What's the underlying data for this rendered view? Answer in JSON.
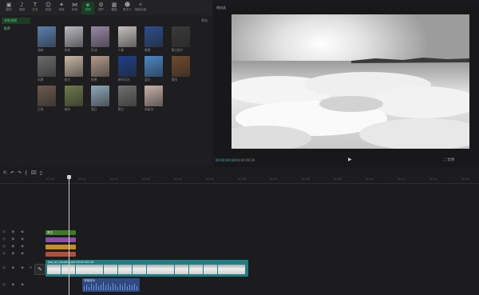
{
  "toolbar": {
    "items": [
      {
        "label": "媒体",
        "icon": "media-icon"
      },
      {
        "label": "音频",
        "icon": "audio-icon"
      },
      {
        "label": "文本",
        "icon": "text-icon"
      },
      {
        "label": "贴纸",
        "icon": "sticker-icon"
      },
      {
        "label": "特效",
        "icon": "effects-icon"
      },
      {
        "label": "转场",
        "icon": "transition-icon"
      },
      {
        "label": "滤镜",
        "icon": "filter-icon"
      },
      {
        "label": "调节",
        "icon": "adjust-icon"
      },
      {
        "label": "模板",
        "icon": "template-icon"
      },
      {
        "label": "数字人",
        "icon": "avatar-icon"
      },
      {
        "label": "智能包装",
        "icon": "smart-pack-icon"
      }
    ],
    "active_index": 6
  },
  "media": {
    "categories": [
      {
        "label": "本地滤镜"
      },
      {
        "label": "推荐"
      }
    ],
    "sort_label": "筛选",
    "thumbs": [
      {
        "label": "清新",
        "color": "#5a7fae"
      },
      {
        "label": "质感",
        "color": "#b9b9c2"
      },
      {
        "label": "奶油",
        "color": "#9a88a6"
      },
      {
        "label": "人像",
        "color": "#c5c2bd"
      },
      {
        "label": "美食",
        "color": "#2c4e8c"
      },
      {
        "label": "黑白胶片",
        "color": "#3a3a3a"
      },
      {
        "label": "风景",
        "color": "#6b6b6b"
      },
      {
        "label": "复古",
        "color": "#c7b7a6"
      },
      {
        "label": "夜景",
        "color": "#b19b8a"
      },
      {
        "label": "城市风光",
        "color": "#1d3f88"
      },
      {
        "label": "蓝天",
        "color": "#4a88c9"
      },
      {
        "label": "暖阳",
        "color": "#6f4a2f"
      },
      {
        "label": "日系",
        "color": "#6c5a4f"
      },
      {
        "label": "森系",
        "color": "#6e7a4a"
      },
      {
        "label": "落日",
        "color": "#8fa7b8"
      },
      {
        "label": "黑白",
        "color": "#707070"
      },
      {
        "label": "高级灰",
        "color": "#c9b2aa"
      }
    ]
  },
  "preview": {
    "title": "播放器",
    "time_current": "00:00:00:00",
    "time_total": "00:00:09:26",
    "ratio_label": "比例",
    "colors": {
      "sky": "#cfcfcf",
      "cloud": "#f0f0f0"
    }
  },
  "timeline": {
    "tool_icons": [
      "select-icon",
      "undo-icon",
      "redo-icon",
      "split-icon",
      "delete-icon",
      "freeze-icon"
    ],
    "ticks": [
      "00:00",
      "00:01",
      "00:02",
      "00:03",
      "00:04",
      "00:05",
      "00:06",
      "00:07",
      "00:08",
      "00:09",
      "00:10",
      "00:11",
      "00:12",
      "00:13",
      "00:14"
    ],
    "tracks": {
      "filter": {
        "label": "黑白",
        "color": "#3f7a2a"
      },
      "effect": {
        "label": "",
        "color": "#8a4fa6"
      },
      "sticker": {
        "label": "",
        "color": "#c58e2b"
      },
      "text": {
        "label": "",
        "color": "#b0503a"
      }
    },
    "main_clip": {
      "title": "sea_of_clouds.mp4  00:00:09:26",
      "color": "#1f7e86"
    },
    "audio_clip": {
      "label": "背景音乐",
      "color": "#2f4a82"
    }
  }
}
